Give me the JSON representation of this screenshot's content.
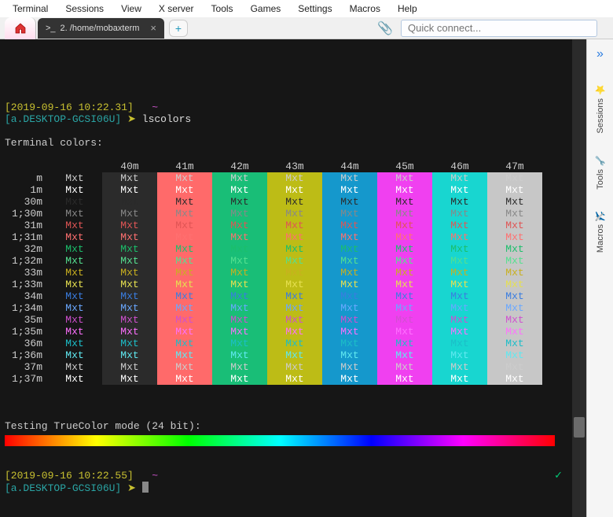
{
  "menubar": [
    "Terminal",
    "Sessions",
    "View",
    "X server",
    "Tools",
    "Games",
    "Settings",
    "Macros",
    "Help"
  ],
  "tab": {
    "title": "2. /home/mobaxterm"
  },
  "quick_connect": {
    "placeholder": "Quick connect..."
  },
  "sidebar_tabs": [
    "Sessions",
    "Tools",
    "Macros"
  ],
  "prompt1": {
    "ts": "[2019-09-16 10:22.31]",
    "tilde": "~",
    "host": "[a.DESKTOP-GCSI06U]",
    "arrow": "➤",
    "cmd": "lscolors"
  },
  "section_title": "Terminal colors:",
  "truecolor_title": "Testing TrueColor mode (24 bit):",
  "prompt2": {
    "ts": "[2019-09-16 10:22.55]",
    "tilde": "~",
    "host": "[a.DESKTOP-GCSI06U]",
    "arrow": "➤"
  },
  "checkmark": "✓",
  "chart_data": {
    "type": "table",
    "title": "Terminal colors",
    "columns": [
      "",
      "40m",
      "41m",
      "42m",
      "43m",
      "44m",
      "45m",
      "46m",
      "47m"
    ],
    "bg_colors": {
      "40m": "#2b2b2b",
      "41m": "#ff6a6a",
      "42m": "#19be77",
      "43m": "#bdbc16",
      "44m": "#1598cc",
      "45m": "#f040f0",
      "46m": "#18d6d0",
      "47m": "#c7c7c7"
    },
    "rows": [
      {
        "label": "m",
        "fg": "default",
        "fg_color": "#cccccc"
      },
      {
        "label": "1m",
        "fg": "bold-default",
        "fg_color": "#ffffff"
      },
      {
        "label": "30m",
        "fg": "30",
        "fg_color": "#2b2b2b"
      },
      {
        "label": "1;30m",
        "fg": "1;30",
        "fg_color": "#888888"
      },
      {
        "label": "31m",
        "fg": "31",
        "fg_color": "#e05555"
      },
      {
        "label": "1;31m",
        "fg": "1;31",
        "fg_color": "#ff7070"
      },
      {
        "label": "32m",
        "fg": "32",
        "fg_color": "#1bbf6b"
      },
      {
        "label": "1;32m",
        "fg": "1;32",
        "fg_color": "#55e090"
      },
      {
        "label": "33m",
        "fg": "33",
        "fg_color": "#c9b020"
      },
      {
        "label": "1;33m",
        "fg": "1;33",
        "fg_color": "#e6e050"
      },
      {
        "label": "34m",
        "fg": "34",
        "fg_color": "#3a7de0"
      },
      {
        "label": "1;34m",
        "fg": "1;34",
        "fg_color": "#6aa8ff"
      },
      {
        "label": "35m",
        "fg": "35",
        "fg_color": "#d050d0"
      },
      {
        "label": "1;35m",
        "fg": "1;35",
        "fg_color": "#ff70ff"
      },
      {
        "label": "36m",
        "fg": "36",
        "fg_color": "#1cbec8"
      },
      {
        "label": "1;36m",
        "fg": "1;36",
        "fg_color": "#60e8f0"
      },
      {
        "label": "37m",
        "fg": "37",
        "fg_color": "#cccccc"
      },
      {
        "label": "1;37m",
        "fg": "1;37",
        "fg_color": "#ffffff"
      }
    ],
    "cell_text": "Mxt"
  }
}
